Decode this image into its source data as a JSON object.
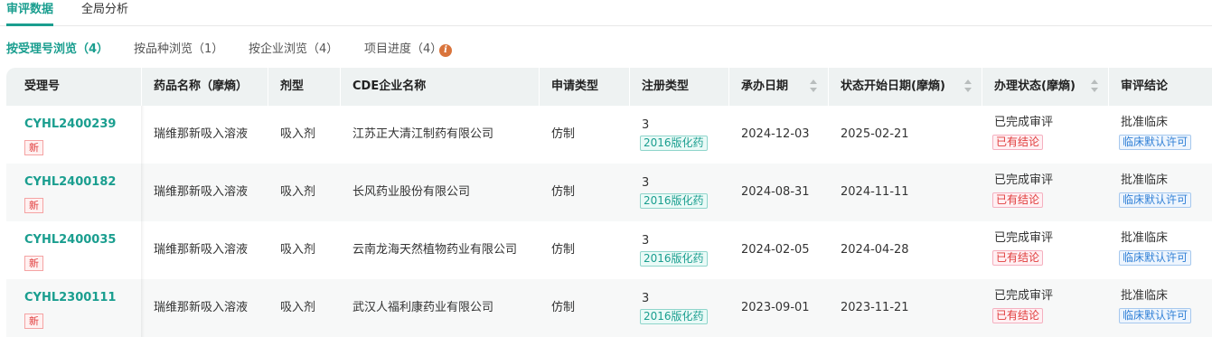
{
  "top_tabs": [
    {
      "label": "审评数据",
      "active": true
    },
    {
      "label": "全局分析",
      "active": false
    }
  ],
  "sub_tabs": [
    {
      "label": "按受理号浏览（4）",
      "active": true
    },
    {
      "label": "按品种浏览（1）",
      "active": false
    },
    {
      "label": "按企业浏览（4）",
      "active": false
    },
    {
      "label": "项目进度（4）",
      "active": false
    }
  ],
  "info_icon_glyph": "i",
  "columns": [
    "受理号",
    "药品名称（摩熵）",
    "剂型",
    "CDE企业名称",
    "申请类型",
    "注册类型",
    "承办日期",
    "状态开始日期(摩熵)",
    "办理状态(摩熵)",
    "审评结论"
  ],
  "colors": {
    "accent": "#1a9e8f",
    "new_badge": "#e03c3c",
    "info_icon": "#d9743c",
    "conclusion_tag": "#2f7fd6"
  },
  "rows": [
    {
      "acceptance_no": "CYHL2400239",
      "new_badge": "新",
      "drug_name": "瑞维那新吸入溶液",
      "dosage_form": "吸入剂",
      "company": "江苏正大清江制药有限公司",
      "application_type": "仿制",
      "reg_class": "3",
      "reg_tag": "2016版化药",
      "undertake_date": "2024-12-03",
      "status_start_date": "2025-02-21",
      "status": "已完成审评",
      "status_tag": "已有结论",
      "conclusion": "批准临床",
      "conclusion_tag": "临床默认许可"
    },
    {
      "acceptance_no": "CYHL2400182",
      "new_badge": "新",
      "drug_name": "瑞维那新吸入溶液",
      "dosage_form": "吸入剂",
      "company": "长风药业股份有限公司",
      "application_type": "仿制",
      "reg_class": "3",
      "reg_tag": "2016版化药",
      "undertake_date": "2024-08-31",
      "status_start_date": "2024-11-11",
      "status": "已完成审评",
      "status_tag": "已有结论",
      "conclusion": "批准临床",
      "conclusion_tag": "临床默认许可"
    },
    {
      "acceptance_no": "CYHL2400035",
      "new_badge": "新",
      "drug_name": "瑞维那新吸入溶液",
      "dosage_form": "吸入剂",
      "company": "云南龙海天然植物药业有限公司",
      "application_type": "仿制",
      "reg_class": "3",
      "reg_tag": "2016版化药",
      "undertake_date": "2024-02-05",
      "status_start_date": "2024-04-28",
      "status": "已完成审评",
      "status_tag": "已有结论",
      "conclusion": "批准临床",
      "conclusion_tag": "临床默认许可"
    },
    {
      "acceptance_no": "CYHL2300111",
      "new_badge": "新",
      "drug_name": "瑞维那新吸入溶液",
      "dosage_form": "吸入剂",
      "company": "武汉人福利康药业有限公司",
      "application_type": "仿制",
      "reg_class": "3",
      "reg_tag": "2016版化药",
      "undertake_date": "2023-09-01",
      "status_start_date": "2023-11-21",
      "status": "已完成审评",
      "status_tag": "已有结论",
      "conclusion": "批准临床",
      "conclusion_tag": "临床默认许可"
    }
  ]
}
